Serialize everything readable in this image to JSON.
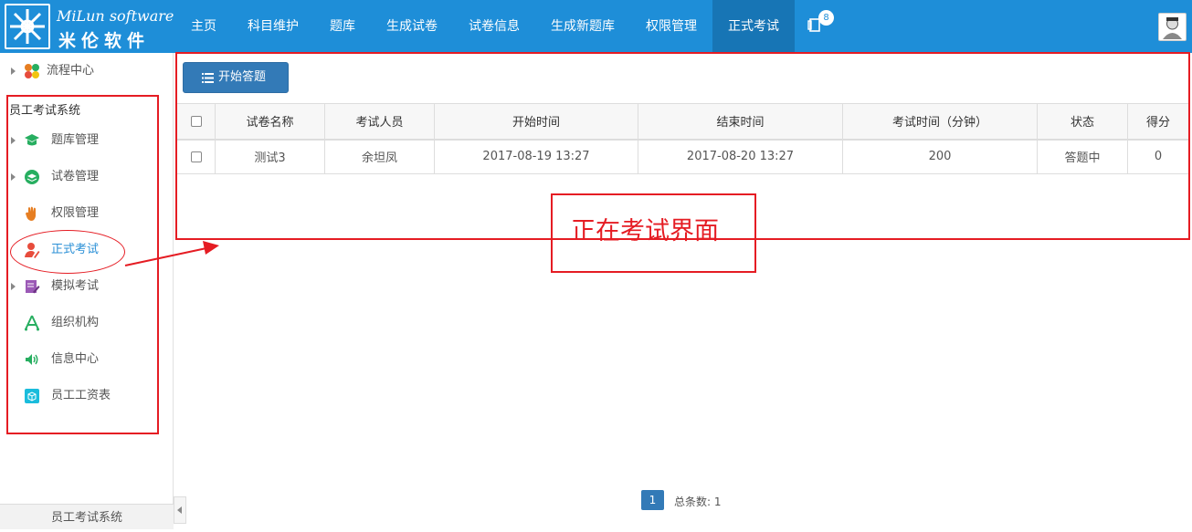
{
  "header": {
    "logo_en": "MiLun software",
    "logo_cn": "米伦软件",
    "nav": [
      "主页",
      "科目维护",
      "题库",
      "生成试卷",
      "试卷信息",
      "生成新题库",
      "权限管理",
      "正式考试"
    ],
    "active_nav": "正式考试",
    "notification_count": "8",
    "colors": {
      "bar": "#1e8ed8",
      "active": "#1775b5"
    }
  },
  "sidebar": {
    "top_item": "流程中心",
    "section_title": "员工考试系统",
    "items": [
      {
        "label": "题库管理",
        "icon": "graduation-icon",
        "expandable": true
      },
      {
        "label": "试卷管理",
        "icon": "layers-icon",
        "expandable": true
      },
      {
        "label": "权限管理",
        "icon": "hand-icon",
        "expandable": false
      },
      {
        "label": "正式考试",
        "icon": "user-pen-icon",
        "expandable": false,
        "active": true
      },
      {
        "label": "模拟考试",
        "icon": "edit-doc-icon",
        "expandable": true
      },
      {
        "label": "组织机构",
        "icon": "org-icon",
        "expandable": false
      },
      {
        "label": "信息中心",
        "icon": "speaker-icon",
        "expandable": false
      },
      {
        "label": "员工工资表",
        "icon": "box-icon",
        "expandable": false
      }
    ],
    "footer": "员工考试系统"
  },
  "toolbar": {
    "start_label": "开始答题"
  },
  "table": {
    "headers": [
      "试卷名称",
      "考试人员",
      "开始时间",
      "结束时间",
      "考试时间（分钟）",
      "状态",
      "得分"
    ],
    "rows": [
      [
        "测试3",
        "余坦凤",
        "2017-08-19 13:27",
        "2017-08-20 13:27",
        "200",
        "答题中",
        "0"
      ]
    ]
  },
  "annotation": {
    "text": "正在考试界面",
    "color": "#e51c23"
  },
  "pagination": {
    "current": "1",
    "total_label": "总条数: 1"
  }
}
